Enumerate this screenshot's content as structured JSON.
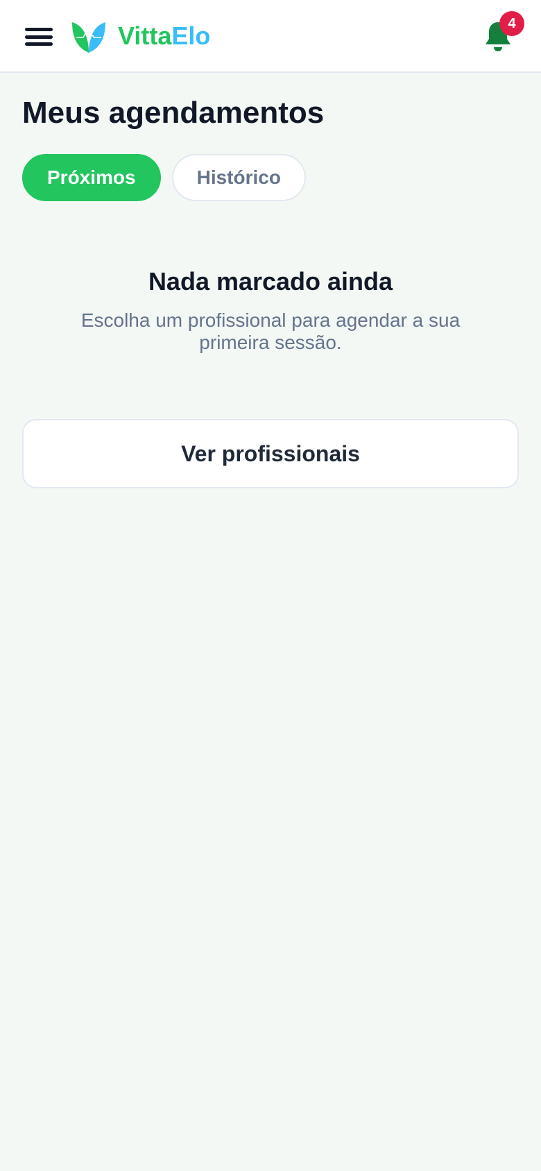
{
  "header": {
    "menu_icon": "hamburger-menu-icon",
    "logo_icon": "leaf-heart-logo-icon",
    "brand_part1": "Vitta",
    "brand_part2": "Elo",
    "notification_icon": "bell-icon",
    "notification_count": "4"
  },
  "page": {
    "title": "Meus agendamentos"
  },
  "tabs": [
    {
      "label": "Próximos",
      "active": true
    },
    {
      "label": "Histórico",
      "active": false
    }
  ],
  "empty_state": {
    "title": "Nada marcado ainda",
    "description": "Escolha um profissional para agendar a sua primeira sessão."
  },
  "cta": {
    "label": "Ver profissionais"
  },
  "colors": {
    "brand_green": "#22c55e",
    "brand_blue": "#38bdf8",
    "badge_red": "#e11d48",
    "bell_green": "#15803d",
    "background": "#f3f8f5"
  }
}
